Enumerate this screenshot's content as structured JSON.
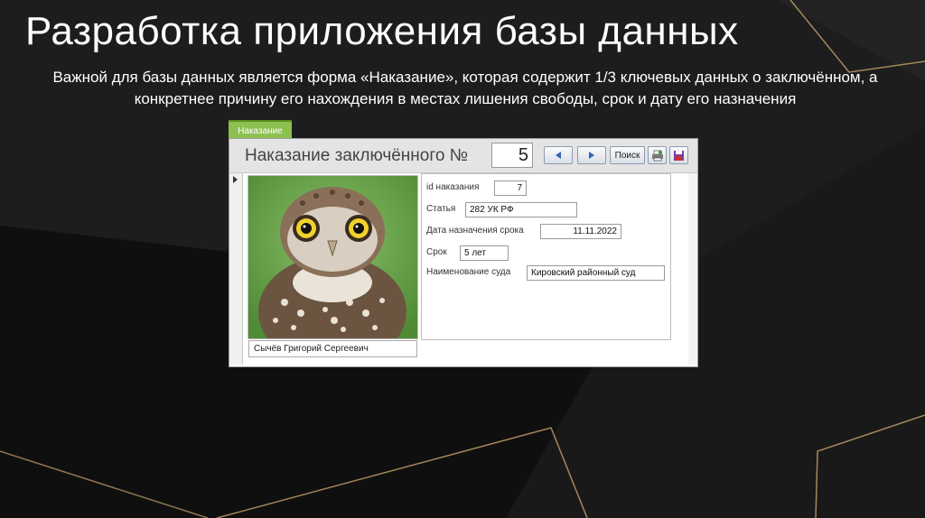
{
  "slide": {
    "title": "Разработка приложения базы данных",
    "description": "Важной для базы данных является форма «Наказание», которая содержит 1/3 ключевых данных о заключённом, а конкретнее причину его нахождения в местах лишения свободы, срок и дату его назначения"
  },
  "form": {
    "tab_label": "Наказание",
    "header_title": "Наказание заключённого №",
    "record_number": "5",
    "search_label": "Поиск",
    "prisoner_name": "Сычёв Григорий Сергеевич",
    "fields": {
      "id_label": "id наказания",
      "id_value": "7",
      "article_label": "Статья",
      "article_value": "282 УК РФ",
      "date_label": "Дата назначения срока",
      "date_value": "11.11.2022",
      "term_label": "Срок",
      "term_value": "5 лет",
      "court_label": "Наименование суда",
      "court_value": "Кировский районный суд"
    },
    "icons": [
      "prev-arrow-icon",
      "next-arrow-icon",
      "print-icon",
      "save-icon"
    ]
  },
  "colors": {
    "background": "#141414",
    "tab_green": "#8cc152",
    "accent_gold": "#c9a46c",
    "nav_blue": "#2f64b4"
  }
}
